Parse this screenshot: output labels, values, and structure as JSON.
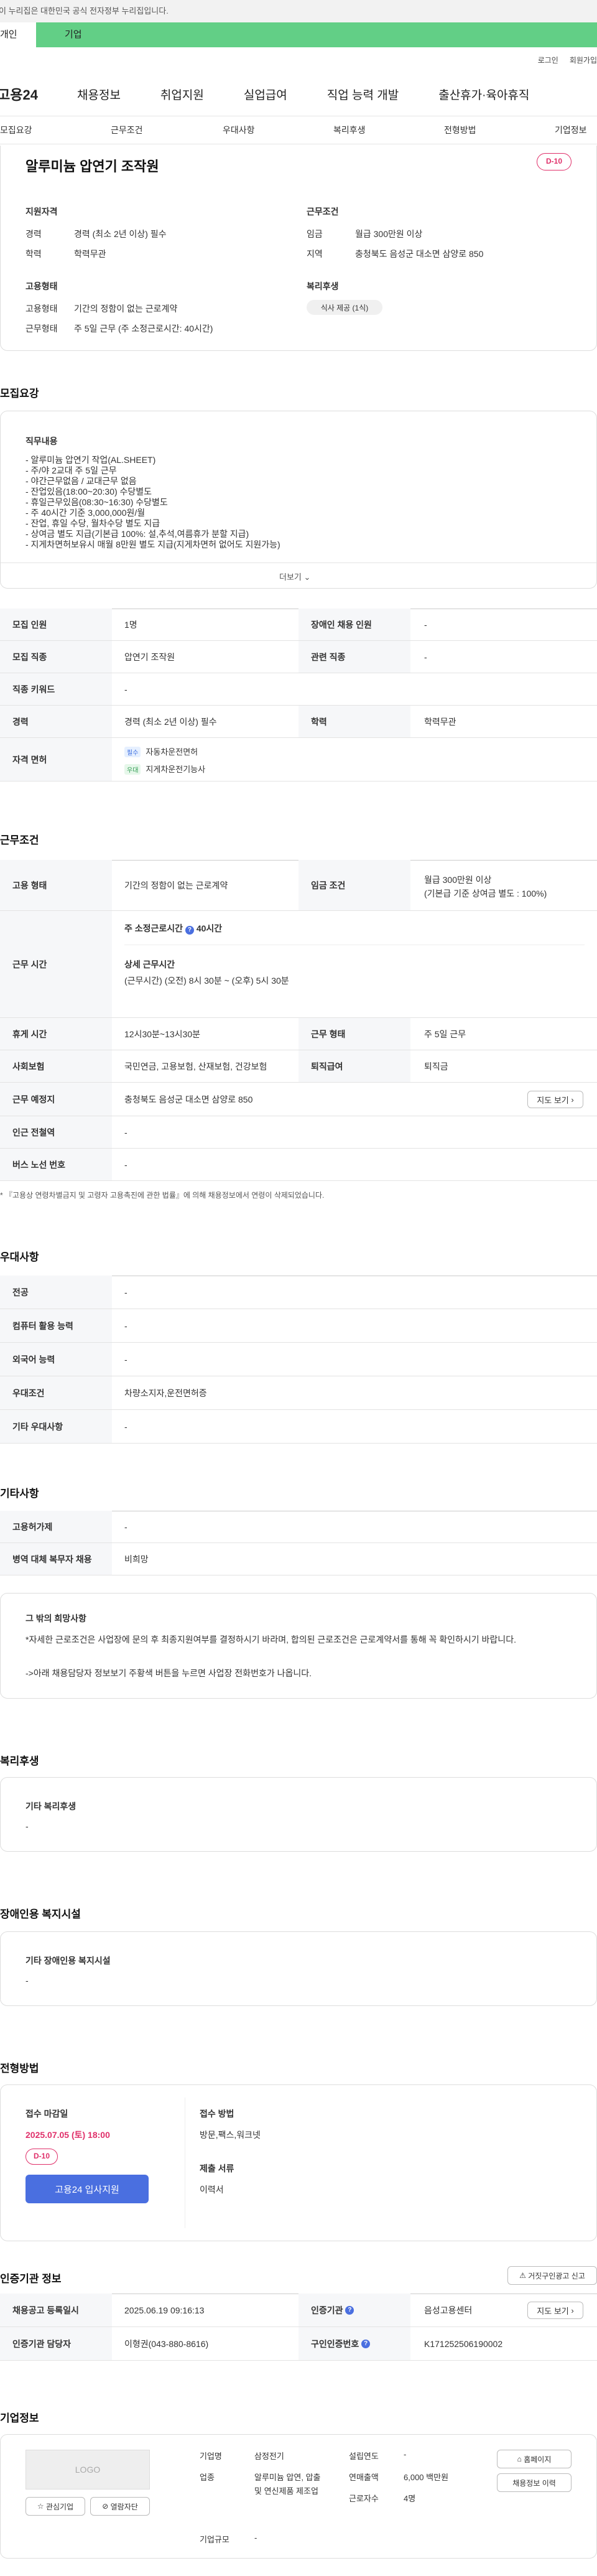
{
  "notice": "이 누리집은 대한민국 공식 전자정부 누리집입니다.",
  "tabs": {
    "individual": "개인",
    "corporate": "기업"
  },
  "toplinks": [
    "로그인",
    "회원가입"
  ],
  "gnb": {
    "logo": "고용24",
    "items": [
      "채용정보",
      "취업지원",
      "실업급여",
      "직업 능력 개발",
      "출산휴가·육아휴직"
    ]
  },
  "subnav": [
    "모집요강",
    "근무조건",
    "우대사항",
    "복리후생",
    "전형방법",
    "기업정보"
  ],
  "summary": {
    "title": "알루미늄 압연기 조작원",
    "dday": "D-10",
    "qual_head": "지원자격",
    "qual": [
      {
        "k": "경력",
        "v": "경력 (최소 2년 이상) 필수"
      },
      {
        "k": "학력",
        "v": "학력무관"
      }
    ],
    "cond_head": "근무조건",
    "cond": [
      {
        "k": "임금",
        "v": "월급 300만원 이상"
      },
      {
        "k": "지역",
        "v": "충청북도 음성군 대소면 삼양로 850"
      }
    ],
    "emp_head": "고용형태",
    "emp": [
      {
        "k": "고용형태",
        "v": "기간의 정함이 없는 근로계약"
      },
      {
        "k": "근무형태",
        "v": "주 5일 근무 (주 소정근로시간: 40시간)"
      }
    ],
    "welfare_head": "복리후생",
    "welfare_pill": "식사 제공 (1식)"
  },
  "recruit": {
    "title": "모집요강",
    "job_head": "직무내용",
    "lines": [
      "- 알루미늄 압연기 작업(AL.SHEET)",
      "- 주/야 2교대 주 5일 근무",
      "- 야간근무없음 / 교대근무 없음",
      "- 잔업있음(18:00~20:30) 수당별도",
      "- 휴일근무있음(08:30~16:30) 수당별도",
      "-  주 40시간 기준 3,000,000원/월",
      "- 잔업, 휴일 수당, 월차수당 별도 지급",
      "- 상여금 별도 지급(기본급 100%: 설,추석,여름휴가 분할 지급)",
      "- 지게차면허보유시 매월 8만원 별도 지급(지게차면허 없어도 지원가능)"
    ],
    "more": "더보기"
  },
  "recruit_table": [
    {
      "h1": "모집 인원",
      "v1": "1명",
      "h2": "장애인 채용 인원",
      "v2": "-"
    },
    {
      "h1": "모집 직종",
      "v1": "압연기 조작원",
      "h2": "관련 직종",
      "v2": "-"
    },
    {
      "h1": "직종 키워드",
      "v1": "-"
    },
    {
      "h1": "경력",
      "v1": "경력 (최소 2년 이상) 필수",
      "h2": "학력",
      "v2": "학력무관"
    }
  ],
  "license": {
    "h": "자격 면허",
    "items": [
      {
        "tag": "필수",
        "v": "자동차운전면허"
      },
      {
        "tag": "우대",
        "v": "지게차운전기능사"
      }
    ]
  },
  "work": {
    "title": "근무조건",
    "emp_h": "고용 형태",
    "emp_v": "기간의 정함이 없는 근로계약",
    "wage_h": "임금 조건",
    "wage_v1": "월급 300만원 이상",
    "wage_v2": "(기본급 기준 상여금 별도 : 100%)",
    "time_h": "근무 시간",
    "time_main": "주 소정근로시간",
    "time_hours": "40시간",
    "time_detail_h": "상세 근무시간",
    "time_detail": "(근무시간) (오전) 8시 30분 ~ (오후) 5시 30분",
    "rows": [
      {
        "h1": "휴게 시간",
        "v1": "12시30분~13시30분",
        "h2": "근무 형태",
        "v2": "주 5일 근무"
      },
      {
        "h1": "사회보험",
        "v1": "국민연금, 고용보험, 산재보험, 건강보험",
        "h2": "퇴직급여",
        "v2": "퇴직금"
      },
      {
        "h1": "근무 예정지",
        "v1": "충청북도 음성군 대소면 삼양로 850",
        "btn": "지도 보기"
      },
      {
        "h1": "인근 전철역",
        "v1": "-"
      },
      {
        "h1": "버스 노선 번호",
        "v1": "-"
      }
    ],
    "note": "* 『고용상 연령차별금지 및 고령자 고용촉진에 관한 법률』에 의해 채용정보에서 연령이 삭제되었습니다."
  },
  "pref": {
    "title": "우대사항",
    "rows": [
      {
        "h": "전공",
        "v": "-"
      },
      {
        "h": "컴퓨터 활용 능력",
        "v": "-"
      },
      {
        "h": "외국어 능력",
        "v": "-"
      },
      {
        "h": "우대조건",
        "v": "차량소지자,운전면허증"
      },
      {
        "h": "기타 우대사항",
        "v": "-"
      }
    ]
  },
  "etc": {
    "title": "기타사항",
    "rows": [
      {
        "h": "고용허가제",
        "v": "-"
      },
      {
        "h": "병역 대체 복무자 채용",
        "v": "비희망"
      }
    ],
    "wish_h": "그 밖의 희망사항",
    "wish1": "*자세한 근로조건은 사업장에 문의 후 최종지원여부를 결정하시기 바라며, 합의된 근로조건은 근로계약서를 통해 꼭 확인하시기 바랍니다.",
    "wish2": "->아래 채용담당자 정보보기 주황색 버튼을 누르면 사업장 전화번호가 나옵니다."
  },
  "benefit": {
    "title": "복리후생",
    "h": "기타 복리후생",
    "v": "-"
  },
  "disabled": {
    "title": "장애인용 복지시설",
    "h": "기타 장애인용 복지시설",
    "v": "-"
  },
  "screening": {
    "title": "전형방법",
    "deadline_h": "접수 마감일",
    "deadline": "2025.07.05 (토) 18:00",
    "dday": "D-10",
    "apply": "고용24 입사지원",
    "method_h": "접수 방법",
    "method": "방문,팩스,워크넷",
    "docs_h": "제출 서류",
    "docs": "이력서"
  },
  "cert": {
    "title": "인증기관 정보",
    "report_btn": "거짓구인광고 신고",
    "r1": {
      "h1": "채용공고 등록일시",
      "v1": "2025.06.19 09:16:13",
      "h2": "인증기관",
      "v2": "음성고용센터",
      "btn": "지도 보기"
    },
    "r2": {
      "h1": "인증기관 담당자",
      "v1": "이형권(043-880-8616)",
      "h2": "구인인증번호",
      "v2": "K171252506190002"
    }
  },
  "company": {
    "title": "기업정보",
    "logo": "LOGO",
    "fav": "관심기업",
    "follow": "열람자단",
    "f": [
      {
        "k": "기업명",
        "v": "삼정전기"
      },
      {
        "k": "업종",
        "v": "알루미늄 압연, 압출 및 연신제품 제조업"
      },
      {
        "k": "기업규모",
        "v": "-"
      }
    ],
    "f2": [
      {
        "k": "설립연도",
        "v": "-"
      },
      {
        "k": "연매출액",
        "v": "6,000 백만원"
      },
      {
        "k": "근로자수",
        "v": "4명"
      }
    ],
    "homepage": "홈페이지",
    "other": "채용정보 이력"
  }
}
